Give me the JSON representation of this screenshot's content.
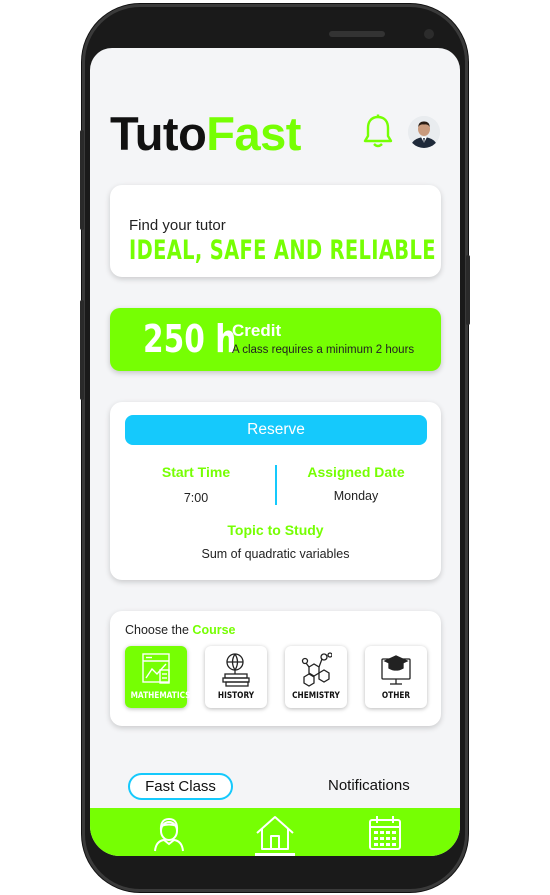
{
  "header": {
    "brand_part1": "Tuto",
    "brand_part2": "Fast",
    "icons": [
      "bell-icon",
      "avatar"
    ]
  },
  "hero": {
    "subtitle": "Find your tutor",
    "title": "IDEAL, SAFE AND RELIABLE"
  },
  "credit": {
    "hours": "250 h",
    "title": "Credit",
    "description": "A class requires a minimum 2 hours"
  },
  "reservation": {
    "button_label": "Reserve",
    "start_time_label": "Start Time",
    "start_time_value": "7:00",
    "assigned_date_label": "Assigned Date",
    "assigned_date_value": "Monday",
    "topic_label": "Topic to Study",
    "topic_value": "Sum of quadratic variables"
  },
  "courses": {
    "prompt": "Choose the",
    "prompt_accent": "Course",
    "items": [
      {
        "label": "MATHEMATICS",
        "icon": "mathematics-icon",
        "selected": true
      },
      {
        "label": "HISTORY",
        "icon": "history-icon",
        "selected": false
      },
      {
        "label": "CHEMISTRY",
        "icon": "chemistry-icon",
        "selected": false
      },
      {
        "label": "OTHER",
        "icon": "other-icon",
        "selected": false
      }
    ]
  },
  "tabs": {
    "fast_class": "Fast Class",
    "notifications": "Notifications"
  },
  "navbar": {
    "items": [
      "profile-icon",
      "home-icon",
      "calendar-icon"
    ],
    "active": "home-icon"
  },
  "colors": {
    "accent_green": "#76ff03",
    "accent_blue": "#15c9fc",
    "text": "#111111"
  }
}
